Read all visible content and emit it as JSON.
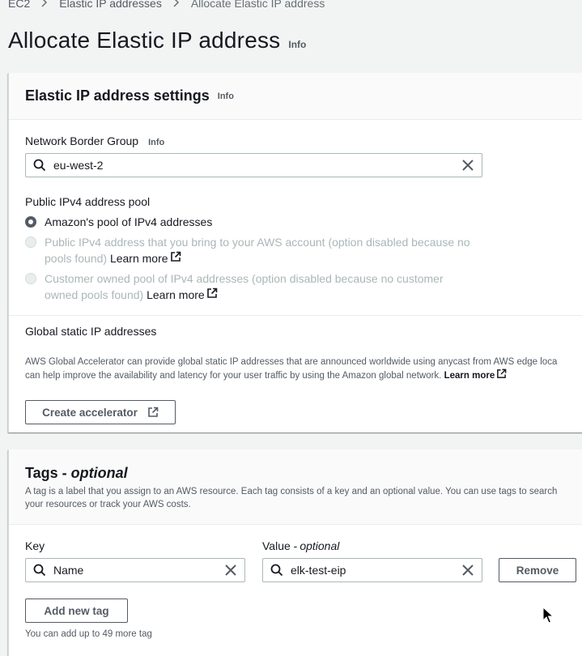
{
  "breadcrumb": {
    "items": [
      "EC2",
      "Elastic IP addresses"
    ],
    "current": "Allocate Elastic IP address"
  },
  "header": {
    "title": "Allocate Elastic IP address",
    "info": "Info"
  },
  "settings": {
    "title": "Elastic IP address settings",
    "info": "Info",
    "nbg_label": "Network Border Group",
    "nbg_info": "Info",
    "nbg_value": "eu-west-2",
    "pool_label": "Public IPv4 address pool",
    "pool_options": [
      {
        "label": "Amazon's pool of IPv4 addresses",
        "selected": true,
        "disabled": false
      },
      {
        "label_line1": "Public IPv4 address that you bring to your AWS account (option disabled because no",
        "label_line2": "pools found)",
        "learn_more": "Learn more",
        "selected": false,
        "disabled": true
      },
      {
        "label_line1": "Customer owned pool of IPv4 addresses (option disabled because no customer",
        "label_line2": "owned pools found)",
        "learn_more": "Learn more",
        "selected": false,
        "disabled": true
      }
    ],
    "global_label": "Global static IP addresses",
    "global_desc_line1": "AWS Global Accelerator can provide global static IP addresses that are announced worldwide using anycast from AWS edge loca",
    "global_desc_line2": "can help improve the availability and latency for your user traffic by using the Amazon global network.",
    "global_learn_more": "Learn more",
    "create_accelerator": "Create accelerator"
  },
  "tags": {
    "title": "Tags - ",
    "title_optional": "optional",
    "desc_line1": "A tag is a label that you assign to an AWS resource. Each tag consists of a key and an optional value. You can use tags to search",
    "desc_line2": "your resources or track your AWS costs.",
    "key_label": "Key",
    "value_label": "Value - ",
    "value_label_optional": "optional",
    "rows": [
      {
        "key": "Name",
        "value": "elk-test-eip"
      }
    ],
    "remove": "Remove",
    "add_new_tag": "Add new tag",
    "limit_note": "You can add up to 49 more tag"
  },
  "colors": {
    "page_bg": "#f2f3f3",
    "text": "#16191f",
    "muted": "#545b64",
    "disabled": "#aab7b8",
    "border": "#aab7b8"
  }
}
